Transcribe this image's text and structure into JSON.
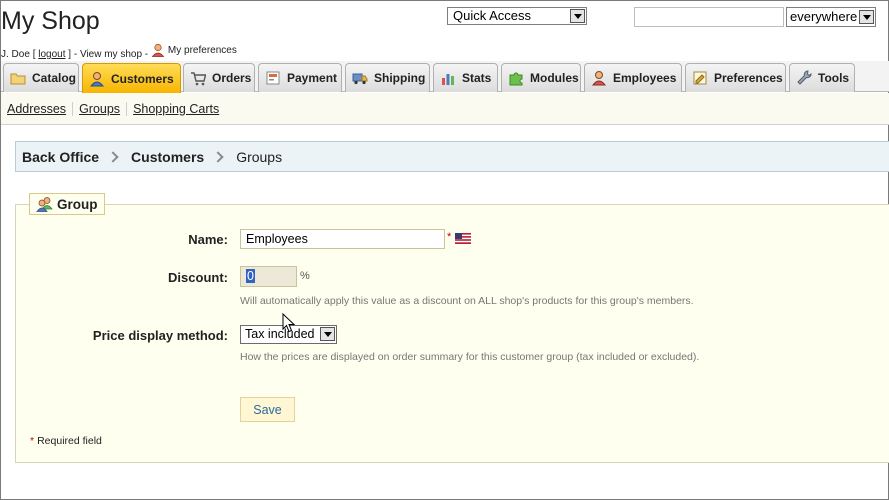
{
  "header": {
    "shop_title": "My Shop",
    "user_name": "J. Doe",
    "logout_label": "logout",
    "view_shop_label": "View my shop",
    "preferences_label": "My preferences",
    "quick_access": "Quick Access",
    "search_value": "",
    "search_scope": "everywhere"
  },
  "tabs": [
    {
      "label": "Catalog",
      "icon": "folder-icon",
      "active": false
    },
    {
      "label": "Customers",
      "icon": "user-icon",
      "active": true
    },
    {
      "label": "Orders",
      "icon": "cart-icon",
      "active": false
    },
    {
      "label": "Payment",
      "icon": "payment-icon",
      "active": false
    },
    {
      "label": "Shipping",
      "icon": "truck-icon",
      "active": false
    },
    {
      "label": "Stats",
      "icon": "bar-chart-icon",
      "active": false
    },
    {
      "label": "Modules",
      "icon": "puzzle-icon",
      "active": false
    },
    {
      "label": "Employees",
      "icon": "employee-icon",
      "active": false
    },
    {
      "label": "Preferences",
      "icon": "preferences-icon",
      "active": false
    },
    {
      "label": "Tools",
      "icon": "wrench-icon",
      "active": false
    }
  ],
  "subtabs": [
    "Addresses",
    "Groups",
    "Shopping Carts"
  ],
  "breadcrumb": [
    "Back Office",
    "Customers",
    "Groups"
  ],
  "form": {
    "legend": "Group",
    "name_label": "Name:",
    "name_value": "Employees",
    "required_star": "*",
    "discount_label": "Discount:",
    "discount_value": "0",
    "discount_unit": "%",
    "discount_hint": "Will automatically apply this value as a discount on ALL shop's products for this group's members.",
    "price_label": "Price display method:",
    "price_value": "Tax included",
    "price_hint": "How the prices are displayed on order summary for this customer group (tax included or excluded).",
    "save_label": "Save",
    "required_note": "Required field"
  },
  "colors": {
    "active_tab": "#f7b500",
    "breadcrumb_bg": "#ecf3f6",
    "fieldset_bg": "#fffff0",
    "required_star": "#cc0000",
    "save_text": "#2a6aa0"
  }
}
